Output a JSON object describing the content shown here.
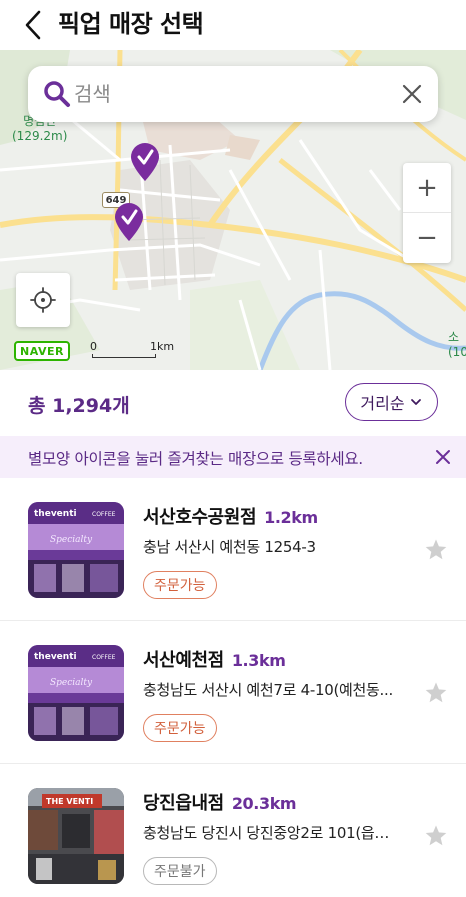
{
  "header": {
    "title": "픽업 매장 선택"
  },
  "search": {
    "placeholder": "검색",
    "value": ""
  },
  "map": {
    "labels": [
      {
        "text": "명림산\n(129.2m)"
      },
      {
        "text": "소\n(10"
      }
    ],
    "road_number": "649",
    "brand": "NAVER",
    "scale_zero": "0",
    "scale_km": "1km",
    "zoom_in": "+",
    "zoom_out": "−"
  },
  "count_bar": {
    "count_text": "총 1,294개",
    "sort_label": "거리순"
  },
  "notice": {
    "text": "별모양 아이콘을 눌러 즐겨찾는 매장으로 등록하세요."
  },
  "stores": [
    {
      "name": "서산호수공원점",
      "distance": "1.2km",
      "address": "충남 서산시 예천동 1254-3",
      "order_status": "주문가능",
      "orderable": true
    },
    {
      "name": "서산예천점",
      "distance": "1.3km",
      "address": "충청남도 서산시 예천7로 4-10(예천동...",
      "order_status": "주문가능",
      "orderable": true
    },
    {
      "name": "당진읍내점",
      "distance": "20.3km",
      "address": "충청남도 당진시 당진중앙2로 101(읍…",
      "order_status": "주문불가",
      "orderable": false
    }
  ],
  "colors": {
    "brand_purple": "#6b2f99",
    "order_on": "#d2603c",
    "notice_bg": "#f6eefb"
  }
}
